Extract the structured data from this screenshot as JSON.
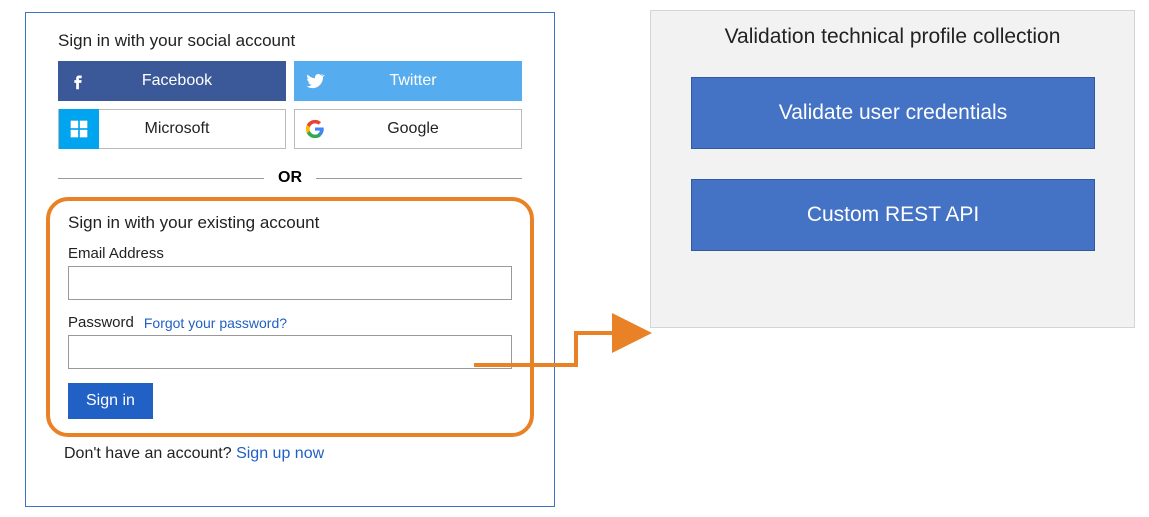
{
  "login": {
    "social_heading": "Sign in with your social account",
    "providers": {
      "facebook": "Facebook",
      "twitter": "Twitter",
      "microsoft": "Microsoft",
      "google": "Google"
    },
    "or_label": "OR",
    "existing_heading": "Sign in with your existing account",
    "email_label": "Email Address",
    "email_value": "",
    "password_label": "Password",
    "password_value": "",
    "forgot_label": "Forgot your password?",
    "signin_label": "Sign in",
    "no_account_text": "Don't have an account?",
    "signup_link": "Sign up now"
  },
  "validation_panel": {
    "title": "Validation technical profile collection",
    "items": [
      "Validate user credentials",
      "Custom REST API"
    ]
  }
}
